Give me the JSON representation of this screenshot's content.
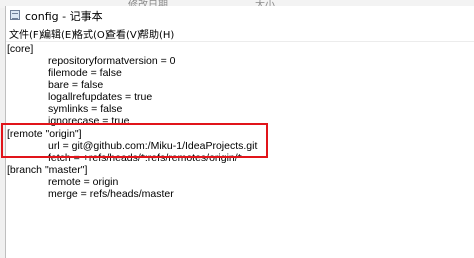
{
  "explorer": {
    "col_modified": "修改日期",
    "col_size": "大小"
  },
  "window": {
    "title": "config - 记事本",
    "icon": "notepad-icon"
  },
  "menu": {
    "items": [
      {
        "label": "文件(F)"
      },
      {
        "label": "编辑(E)"
      },
      {
        "label": "格式(O)"
      },
      {
        "label": "查看(V)"
      },
      {
        "label": "帮助(H)"
      }
    ]
  },
  "editor": {
    "lines": [
      "[core]",
      "repositoryformatversion = 0",
      "filemode = false",
      "bare = false",
      "logallrefupdates = true",
      "symlinks = false",
      "ignorecase = true",
      "[remote \"origin\"]",
      "url = git@github.com:/Miku-1/IdeaProjects.git",
      "fetch = +refs/heads/*:refs/remotes/origin/*",
      "[branch \"master\"]",
      "remote = origin",
      "merge = refs/heads/master"
    ]
  },
  "highlight": {
    "color": "#e1141a"
  }
}
